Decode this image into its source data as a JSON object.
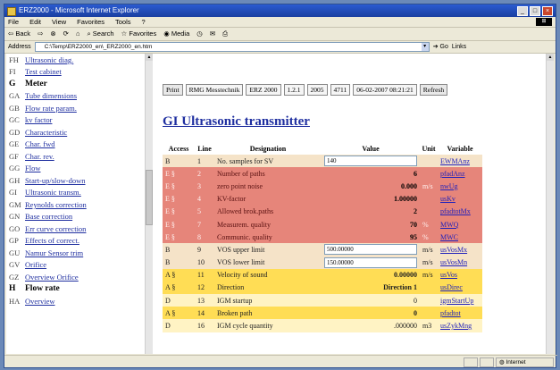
{
  "window": {
    "title": "ERZ2000 - Microsoft Internet Explorer"
  },
  "menubar": {
    "items": [
      "File",
      "Edit",
      "View",
      "Favorites",
      "Tools",
      "?"
    ]
  },
  "toolbar": {
    "back": "Back",
    "search": "Search",
    "favorites": "Favorites",
    "media": "Media"
  },
  "address": {
    "label": "Address",
    "url": "C:\\Temp\\ERZ2000_en\\_ERZ2000_en.htm",
    "go": "Go",
    "links": "Links"
  },
  "sidebar": {
    "items": [
      {
        "code": "FH",
        "label": "Ultrasonic diag.",
        "head": false
      },
      {
        "code": "FI",
        "label": "Test cabinet",
        "head": false
      },
      {
        "code": "G",
        "label": "Meter",
        "head": true
      },
      {
        "code": "GA",
        "label": "Tube dimensions",
        "head": false
      },
      {
        "code": "GB",
        "label": "Flow rate param.",
        "head": false
      },
      {
        "code": "GC",
        "label": "kv factor",
        "head": false
      },
      {
        "code": "GD",
        "label": "Characteristic",
        "head": false
      },
      {
        "code": "GE",
        "label": "Char. fwd",
        "head": false
      },
      {
        "code": "GF",
        "label": "Char. rev.",
        "head": false
      },
      {
        "code": "GG",
        "label": "Flow",
        "head": false
      },
      {
        "code": "GH",
        "label": "Start-up/slow-down",
        "head": false
      },
      {
        "code": "GI",
        "label": "Ultrasonic transm.",
        "head": false
      },
      {
        "code": "GM",
        "label": "Reynolds correction",
        "head": false
      },
      {
        "code": "GN",
        "label": "Base correction",
        "head": false
      },
      {
        "code": "GO",
        "label": "Err curve correction",
        "head": false
      },
      {
        "code": "GP",
        "label": "Effects of correct.",
        "head": false
      },
      {
        "code": "GU",
        "label": "Namur Sensor trim",
        "head": false
      },
      {
        "code": "GV",
        "label": "Orifice",
        "head": false
      },
      {
        "code": "GZ",
        "label": "Overview Orifice",
        "head": false
      },
      {
        "code": "H",
        "label": "Flow rate",
        "head": true
      },
      {
        "code": "HA",
        "label": "Overview",
        "head": false
      }
    ]
  },
  "header": {
    "print": "Print",
    "maker": "RMG Messtechnik",
    "model": "ERZ 2000",
    "version": "1.2.1",
    "year": "2005",
    "serial": "4711",
    "datetime": "06-02-2007 08:21:21",
    "refresh": "Refresh"
  },
  "page": {
    "title": "GI Ultrasonic transmitter"
  },
  "table": {
    "headers": [
      "Access",
      "Line",
      "Designation",
      "Value",
      "Unit",
      "Variable"
    ],
    "rows": [
      {
        "access": "B",
        "line": "1",
        "designation": "No. samples for SV",
        "value": "140",
        "unit": "",
        "variable": "EWMAnz",
        "style": "beige",
        "input": true
      },
      {
        "access": "E §",
        "line": "2",
        "designation": "Number of paths",
        "value": "6",
        "unit": "",
        "variable": "pfadAnz",
        "style": "red",
        "input": false
      },
      {
        "access": "E §",
        "line": "3",
        "designation": "zero point noise",
        "value": "0.000",
        "unit": "m/s",
        "variable": "nwUg",
        "style": "red",
        "input": false
      },
      {
        "access": "E §",
        "line": "4",
        "designation": "KV-factor",
        "value": "1.00000",
        "unit": "",
        "variable": "usKv",
        "style": "red",
        "input": false
      },
      {
        "access": "E §",
        "line": "5",
        "designation": "Allowed brok.paths",
        "value": "2",
        "unit": "",
        "variable": "pfadtotMx",
        "style": "red",
        "input": false
      },
      {
        "access": "E §",
        "line": "7",
        "designation": "Measurem. quality",
        "value": "70",
        "unit": "%",
        "variable": "MWQ",
        "style": "red",
        "input": false
      },
      {
        "access": "E §",
        "line": "8",
        "designation": "Communic. quality",
        "value": "95",
        "unit": "%",
        "variable": "MWC",
        "style": "red",
        "input": false
      },
      {
        "access": "B",
        "line": "9",
        "designation": "VOS upper limit",
        "value": "500.00000",
        "unit": "m/s",
        "variable": "usVosMx",
        "style": "beige",
        "input": true
      },
      {
        "access": "B",
        "line": "10",
        "designation": "VOS lower limit",
        "value": "150.00000",
        "unit": "m/s",
        "variable": "usVosMn",
        "style": "beige",
        "input": true
      },
      {
        "access": "A §",
        "line": "11",
        "designation": "Velocity of sound",
        "value": "0.00000",
        "unit": "m/s",
        "variable": "usVos",
        "style": "yel",
        "input": false
      },
      {
        "access": "A §",
        "line": "12",
        "designation": "Direction",
        "value": "Direction 1",
        "unit": "",
        "variable": "usDirec",
        "style": "yel",
        "input": false
      },
      {
        "access": "D",
        "line": "13",
        "designation": "IGM startup",
        "value": "0",
        "unit": "",
        "variable": "igmStartUp",
        "style": "lyel",
        "input": false
      },
      {
        "access": "A §",
        "line": "14",
        "designation": "Broken path",
        "value": "0",
        "unit": "",
        "variable": "pfadtot",
        "style": "yel",
        "input": false
      },
      {
        "access": "D",
        "line": "16",
        "designation": "IGM cycle quantity",
        "value": ".000000",
        "unit": "m3",
        "variable": "usZykMng",
        "style": "lyel",
        "input": false
      }
    ]
  },
  "status": {
    "zone": "Internet"
  },
  "colors": {
    "red": "#e6857a",
    "beige": "#f5e3c8",
    "yellow": "#ffdd55",
    "light_yellow": "#fff3c4",
    "link": "#1f2fa0"
  }
}
